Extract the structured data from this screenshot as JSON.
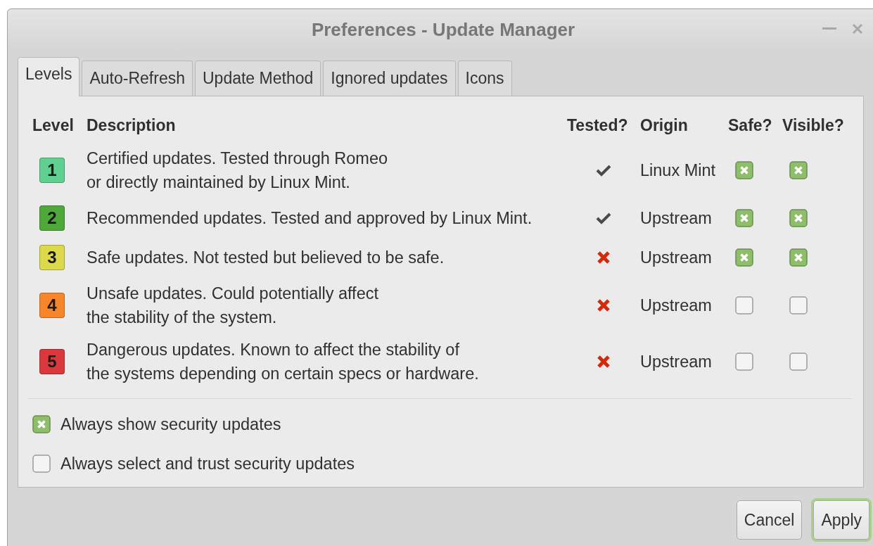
{
  "window": {
    "title": "Preferences - Update Manager"
  },
  "tabs": [
    {
      "label": "Levels",
      "selected": true
    },
    {
      "label": "Auto-Refresh",
      "selected": false
    },
    {
      "label": "Update Method",
      "selected": false
    },
    {
      "label": "Ignored updates",
      "selected": false
    },
    {
      "label": "Icons",
      "selected": false
    }
  ],
  "table": {
    "columns": [
      "Level",
      "Description",
      "Tested?",
      "Origin",
      "Safe?",
      "Visible?"
    ],
    "rows": [
      {
        "level": "1",
        "color": "#5fd08f",
        "description": [
          "Certified updates. Tested through Romeo",
          "or directly maintained by Linux Mint."
        ],
        "tested": true,
        "origin": "Linux Mint",
        "safe": true,
        "visible": true
      },
      {
        "level": "2",
        "color": "#4fa83a",
        "description": [
          "Recommended updates. Tested and approved by Linux Mint."
        ],
        "tested": true,
        "origin": "Upstream",
        "safe": true,
        "visible": true
      },
      {
        "level": "3",
        "color": "#dcd94a",
        "description": [
          "Safe updates. Not tested but believed to be safe."
        ],
        "tested": false,
        "origin": "Upstream",
        "safe": true,
        "visible": true
      },
      {
        "level": "4",
        "color": "#f7862a",
        "description": [
          "Unsafe updates. Could potentially affect",
          "the stability of the system."
        ],
        "tested": false,
        "origin": "Upstream",
        "safe": false,
        "visible": false
      },
      {
        "level": "5",
        "color": "#d9383c",
        "description": [
          "Dangerous updates. Known to affect the stability of",
          "the systems depending on certain specs or hardware."
        ],
        "tested": false,
        "origin": "Upstream",
        "safe": false,
        "visible": false
      }
    ]
  },
  "options": [
    {
      "label": "Always show security updates",
      "checked": true
    },
    {
      "label": "Always select and trust security updates",
      "checked": false
    }
  ],
  "buttons": [
    {
      "label": "Cancel",
      "default": false
    },
    {
      "label": "Apply",
      "default": true
    }
  ]
}
